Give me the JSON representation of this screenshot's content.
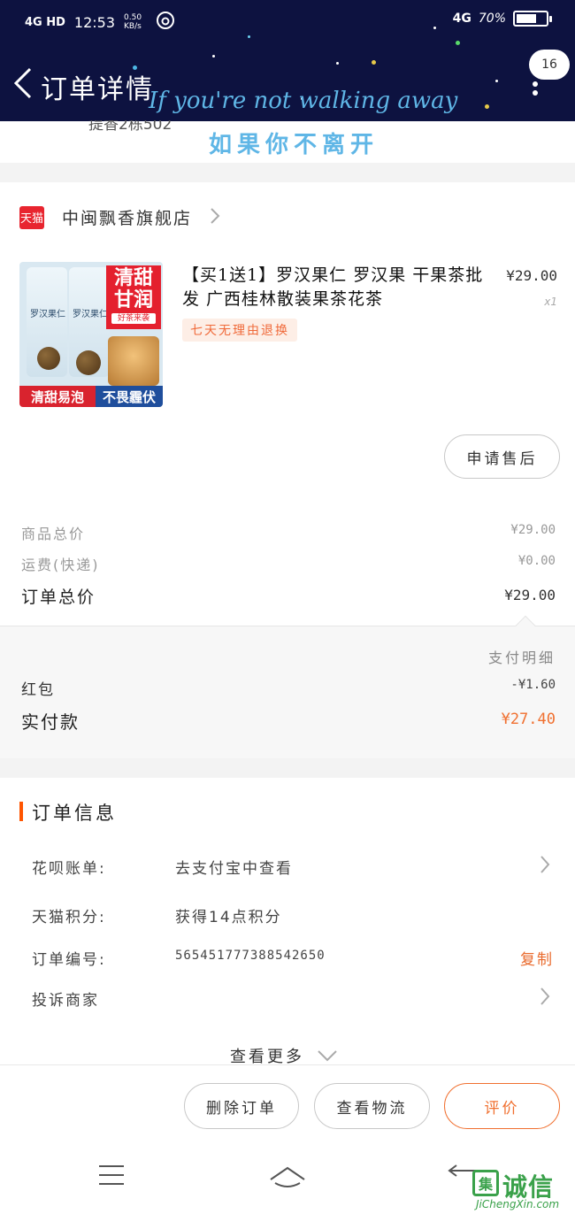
{
  "status_bar": {
    "network": "4G HD",
    "time": "12:53",
    "speed": "0.50 KB/s",
    "network_right": "4G",
    "battery_percent": "70%",
    "battery_level": 0.7
  },
  "header": {
    "title": "订单详情",
    "overlay_en": "If you're not walking away",
    "overlay_zh": "如果你不离开",
    "badge_count": "16"
  },
  "address_fragment": "提香2栋502",
  "store": {
    "badge": "天猫",
    "name": "中闽飘香旗舰店"
  },
  "product": {
    "title": "【买1送1】罗汉果仁 罗汉果 干果茶批发 广西桂林散装果茶花茶",
    "price": "¥29.00",
    "quantity": "x1",
    "tag": "七天无理由退换",
    "image_texts": {
      "red_box": "清甜甘润",
      "red_box_sub": "好茶来袭",
      "can_label": "罗汉果仁",
      "strip_left": "清甜易泡",
      "strip_right": "不畏霾伏"
    },
    "after_sale_button": "申请售后"
  },
  "pricing": {
    "goods_total_label": "商品总价",
    "goods_total_value": "¥29.00",
    "shipping_label": "运费(快递)",
    "shipping_value": "¥0.00",
    "order_total_label": "订单总价",
    "order_total_value": "¥29.00",
    "payment_detail_label": "支付明细",
    "red_packet_label": "红包",
    "red_packet_value": "-¥1.60",
    "paid_label": "实付款",
    "paid_value": "¥27.40"
  },
  "order_info": {
    "section_title": "订单信息",
    "huabei_label": "花呗账单:",
    "huabei_value": "去支付宝中查看",
    "points_label": "天猫积分:",
    "points_value": "获得14点积分",
    "order_no_label": "订单编号:",
    "order_no_value": "565451777388542650",
    "copy_label": "复制",
    "complaint_label": "投诉商家",
    "see_more": "查看更多"
  },
  "actions": {
    "delete": "删除订单",
    "logistics": "查看物流",
    "review": "评价"
  },
  "watermark": {
    "box": "集",
    "text": "诚信",
    "url": "JiChengXin.com"
  },
  "colors": {
    "header_bg": "#0d1240",
    "accent_orange": "#f07030",
    "tmall_red": "#e8252f",
    "overlay_blue": "#5fb6e6"
  }
}
